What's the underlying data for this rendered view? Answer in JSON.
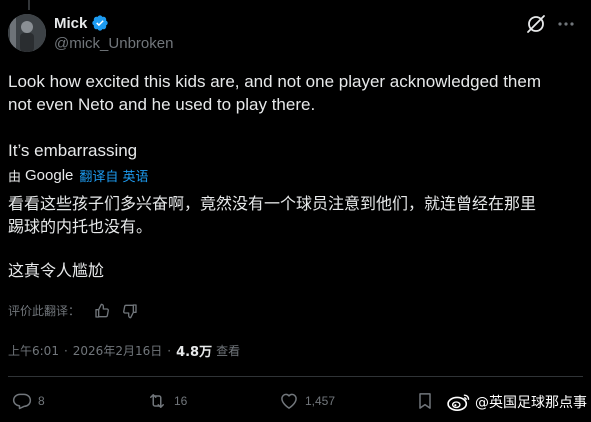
{
  "author": {
    "display_name": "Mick",
    "handle": "@mick_Unbroken",
    "verified": true
  },
  "tweet": {
    "lines": [
      "Look how excited this kids are, and not one player acknowledged them",
      "not even Neto and he used to play there.",
      "It’s embarrassing"
    ]
  },
  "translation": {
    "by": "由",
    "provider": "Google",
    "translated_from": "翻译自 英语",
    "lines": [
      "看看这些孩子们多兴奋啊，竟然没有一个球员注意到他们，就连曾经在那里",
      "踢球的内托也没有。",
      "这真令人尴尬"
    ],
    "rate_label": "评价此翻译："
  },
  "meta": {
    "time": "上午6:01",
    "separator": "·",
    "date": "2026年2月16日",
    "views_count": "4.8万",
    "views_label": "查看"
  },
  "actions": {
    "reply_count": "8",
    "retweet_count": "16",
    "like_count": "1,457"
  },
  "watermark": {
    "text": "@英国足球那点事"
  },
  "colors": {
    "background": "#000000",
    "text": "#e7e9ea",
    "secondary": "#71767b",
    "accent": "#1d9bf0",
    "divider": "#2f3336"
  },
  "icons": {
    "verified": "verified-badge-icon",
    "grok": "grok-icon",
    "more": "more-options-icon",
    "thumbs_up": "thumbs-up-icon",
    "thumbs_down": "thumbs-down-icon",
    "reply": "reply-icon",
    "retweet": "retweet-icon",
    "like": "heart-icon",
    "bookmark": "bookmark-icon",
    "weibo": "weibo-logo-icon"
  }
}
